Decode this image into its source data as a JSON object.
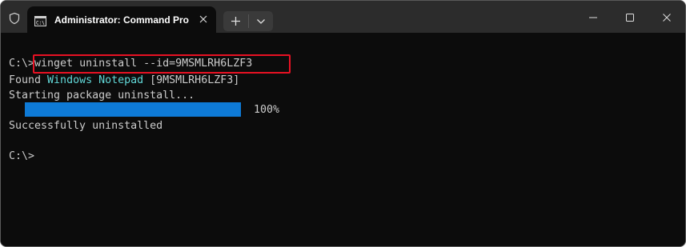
{
  "window": {
    "tab_title": "Administrator: Command Pro",
    "new_tab_glyph": "+",
    "icons": {
      "shield": "shield-icon",
      "tab": "command-prompt-icon",
      "close_tab": "close-icon",
      "dropdown": "chevron-down-icon",
      "minimize": "minimize-icon",
      "maximize": "maximize-icon",
      "close_window": "close-icon"
    }
  },
  "console": {
    "prompt": "C:\\>",
    "command": "winget uninstall --id=9MSMLRH6LZF3",
    "found_prefix": "Found ",
    "found_name": "Windows Notepad",
    "found_id": " [9MSMLRH6LZF3]",
    "starting": "Starting package uninstall...",
    "progress_percent": "100%",
    "progress_value": 1.0,
    "success": "Successfully uninstalled",
    "final_prompt": "C:\\>"
  },
  "colors": {
    "background": "#0c0c0c",
    "text": "#cccccc",
    "highlight_text": "#61d6d6",
    "progress_fill": "#0e7ad6",
    "annotation_border": "#e81123"
  }
}
